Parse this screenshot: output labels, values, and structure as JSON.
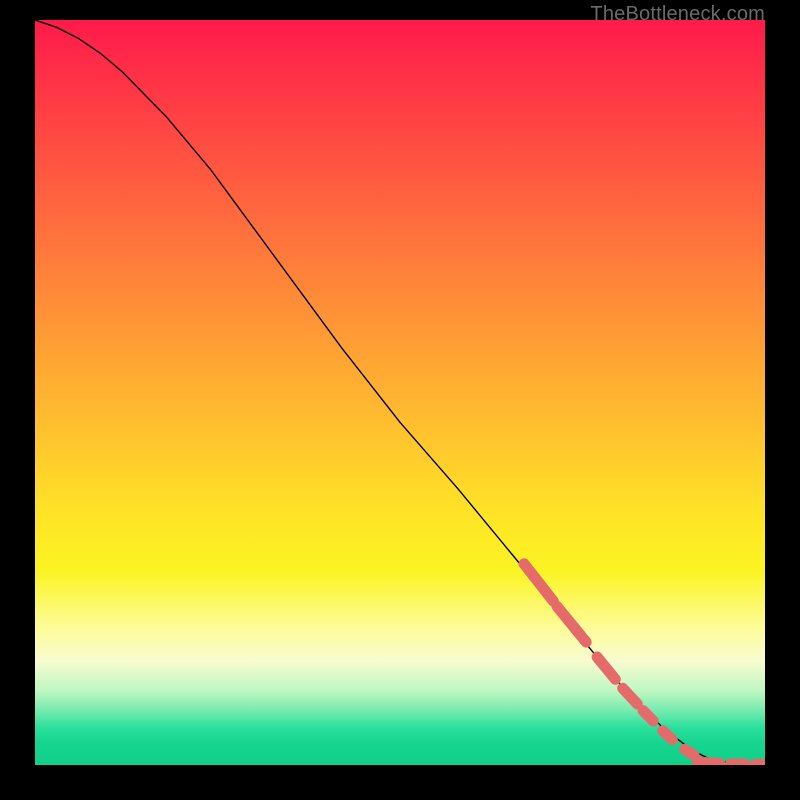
{
  "watermark": "TheBottleneck.com",
  "chart_data": {
    "type": "line",
    "title": "",
    "xlabel": "",
    "ylabel": "",
    "xlim": [
      0,
      100
    ],
    "ylim": [
      0,
      100
    ],
    "grid": false,
    "series": [
      {
        "name": "curve",
        "style": "line-thin-black",
        "x": [
          0,
          3,
          6,
          9,
          12,
          15,
          18,
          21,
          24,
          30,
          36,
          42,
          50,
          58,
          66,
          74,
          80,
          86,
          90,
          92,
          94,
          96,
          98,
          100
        ],
        "y": [
          100,
          99,
          97.5,
          95.5,
          93,
          90,
          87,
          83.5,
          80,
          72,
          64,
          56,
          46,
          37,
          27.5,
          18,
          11,
          5,
          2,
          1,
          0.5,
          0.2,
          0.1,
          0.1
        ]
      },
      {
        "name": "highlight-segments",
        "style": "dashed-thick-salmon",
        "segments": [
          {
            "x": [
              67,
              71
            ],
            "y": [
              27,
              22
            ]
          },
          {
            "x": [
              71.5,
              75.5
            ],
            "y": [
              21.3,
              16.5
            ]
          },
          {
            "x": [
              77,
              79.5
            ],
            "y": [
              14.5,
              11.5
            ]
          },
          {
            "x": [
              80.5,
              82.5
            ],
            "y": [
              10.3,
              8.2
            ]
          },
          {
            "x": [
              83.3,
              84.7
            ],
            "y": [
              7.3,
              5.9
            ]
          },
          {
            "x": [
              86,
              87.3
            ],
            "y": [
              4.6,
              3.4
            ]
          },
          {
            "x": [
              89,
              90.3
            ],
            "y": [
              2.1,
              1.3
            ]
          },
          {
            "x": [
              90.8,
              93.8
            ],
            "y": [
              0.4,
              0.2
            ]
          },
          {
            "x": [
              95.3,
              97.3
            ],
            "y": [
              0.15,
              0.12
            ]
          },
          {
            "x": [
              98.7,
              100
            ],
            "y": [
              0.1,
              0.1
            ]
          }
        ]
      }
    ],
    "colors": {
      "curve": "#000000",
      "highlight": "#e56a6a",
      "background_top": "#ff1a4b",
      "background_bottom": "#10d08a"
    }
  }
}
